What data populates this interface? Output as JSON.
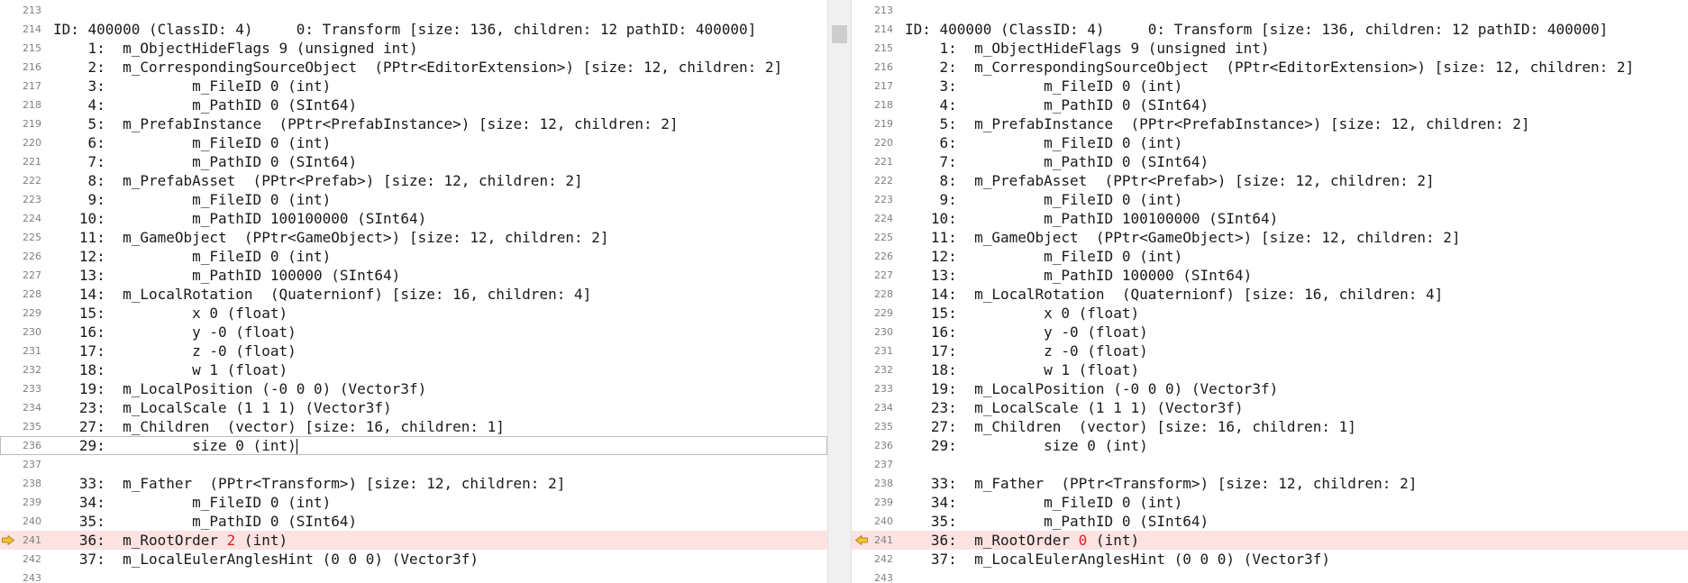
{
  "left": {
    "lines": [
      {
        "num": "213",
        "text": ""
      },
      {
        "num": "214",
        "text": "ID: 400000 (ClassID: 4)     0: Transform [size: 136, children: 12 pathID: 400000]"
      },
      {
        "num": "215",
        "text": "    1:  m_ObjectHideFlags 9 (unsigned int)"
      },
      {
        "num": "216",
        "text": "    2:  m_CorrespondingSourceObject  (PPtr<EditorExtension>) [size: 12, children: 2]"
      },
      {
        "num": "217",
        "text": "    3:          m_FileID 0 (int)"
      },
      {
        "num": "218",
        "text": "    4:          m_PathID 0 (SInt64)"
      },
      {
        "num": "219",
        "text": "    5:  m_PrefabInstance  (PPtr<PrefabInstance>) [size: 12, children: 2]"
      },
      {
        "num": "220",
        "text": "    6:          m_FileID 0 (int)"
      },
      {
        "num": "221",
        "text": "    7:          m_PathID 0 (SInt64)"
      },
      {
        "num": "222",
        "text": "    8:  m_PrefabAsset  (PPtr<Prefab>) [size: 12, children: 2]"
      },
      {
        "num": "223",
        "text": "    9:          m_FileID 0 (int)"
      },
      {
        "num": "224",
        "text": "   10:          m_PathID 100100000 (SInt64)"
      },
      {
        "num": "225",
        "text": "   11:  m_GameObject  (PPtr<GameObject>) [size: 12, children: 2]"
      },
      {
        "num": "226",
        "text": "   12:          m_FileID 0 (int)"
      },
      {
        "num": "227",
        "text": "   13:          m_PathID 100000 (SInt64)"
      },
      {
        "num": "228",
        "text": "   14:  m_LocalRotation  (Quaternionf) [size: 16, children: 4]"
      },
      {
        "num": "229",
        "text": "   15:          x 0 (float)"
      },
      {
        "num": "230",
        "text": "   16:          y -0 (float)"
      },
      {
        "num": "231",
        "text": "   17:          z -0 (float)"
      },
      {
        "num": "232",
        "text": "   18:          w 1 (float)"
      },
      {
        "num": "233",
        "text": "   19:  m_LocalPosition (-0 0 0) (Vector3f)"
      },
      {
        "num": "234",
        "text": "   23:  m_LocalScale (1 1 1) (Vector3f)"
      },
      {
        "num": "235",
        "text": "   27:  m_Children  (vector) [size: 16, children: 1]"
      },
      {
        "num": "236",
        "text": "   29:          size 0 (int)"
      },
      {
        "num": "237",
        "text": ""
      },
      {
        "num": "238",
        "text": "   33:  m_Father  (PPtr<Transform>) [size: 12, children: 2]"
      },
      {
        "num": "239",
        "text": "   34:          m_FileID 0 (int)"
      },
      {
        "num": "240",
        "text": "   35:          m_PathID 0 (SInt64)"
      },
      {
        "num": "241",
        "pre": "   36:  m_RootOrder ",
        "hl": "2",
        "post": " (int)"
      },
      {
        "num": "242",
        "text": "   37:  m_LocalEulerAnglesHint (0 0 0) (Vector3f)"
      },
      {
        "num": "243",
        "text": ""
      }
    ]
  },
  "right": {
    "lines": [
      {
        "num": "213",
        "text": ""
      },
      {
        "num": "214",
        "text": "ID: 400000 (ClassID: 4)     0: Transform [size: 136, children: 12 pathID: 400000]"
      },
      {
        "num": "215",
        "text": "    1:  m_ObjectHideFlags 9 (unsigned int)"
      },
      {
        "num": "216",
        "text": "    2:  m_CorrespondingSourceObject  (PPtr<EditorExtension>) [size: 12, children: 2]"
      },
      {
        "num": "217",
        "text": "    3:          m_FileID 0 (int)"
      },
      {
        "num": "218",
        "text": "    4:          m_PathID 0 (SInt64)"
      },
      {
        "num": "219",
        "text": "    5:  m_PrefabInstance  (PPtr<PrefabInstance>) [size: 12, children: 2]"
      },
      {
        "num": "220",
        "text": "    6:          m_FileID 0 (int)"
      },
      {
        "num": "221",
        "text": "    7:          m_PathID 0 (SInt64)"
      },
      {
        "num": "222",
        "text": "    8:  m_PrefabAsset  (PPtr<Prefab>) [size: 12, children: 2]"
      },
      {
        "num": "223",
        "text": "    9:          m_FileID 0 (int)"
      },
      {
        "num": "224",
        "text": "   10:          m_PathID 100100000 (SInt64)"
      },
      {
        "num": "225",
        "text": "   11:  m_GameObject  (PPtr<GameObject>) [size: 12, children: 2]"
      },
      {
        "num": "226",
        "text": "   12:          m_FileID 0 (int)"
      },
      {
        "num": "227",
        "text": "   13:          m_PathID 100000 (SInt64)"
      },
      {
        "num": "228",
        "text": "   14:  m_LocalRotation  (Quaternionf) [size: 16, children: 4]"
      },
      {
        "num": "229",
        "text": "   15:          x 0 (float)"
      },
      {
        "num": "230",
        "text": "   16:          y -0 (float)"
      },
      {
        "num": "231",
        "text": "   17:          z -0 (float)"
      },
      {
        "num": "232",
        "text": "   18:          w 1 (float)"
      },
      {
        "num": "233",
        "text": "   19:  m_LocalPosition (-0 0 0) (Vector3f)"
      },
      {
        "num": "234",
        "text": "   23:  m_LocalScale (1 1 1) (Vector3f)"
      },
      {
        "num": "235",
        "text": "   27:  m_Children  (vector) [size: 16, children: 1]"
      },
      {
        "num": "236",
        "text": "   29:          size 0 (int)"
      },
      {
        "num": "237",
        "text": ""
      },
      {
        "num": "238",
        "text": "   33:  m_Father  (PPtr<Transform>) [size: 12, children: 2]"
      },
      {
        "num": "239",
        "text": "   34:          m_FileID 0 (int)"
      },
      {
        "num": "240",
        "text": "   35:          m_PathID 0 (SInt64)"
      },
      {
        "num": "241",
        "pre": "   36:  m_RootOrder ",
        "hl": "0",
        "post": " (int)"
      },
      {
        "num": "242",
        "text": "   37:  m_LocalEulerAnglesHint (0 0 0) (Vector3f)"
      },
      {
        "num": "243",
        "text": ""
      }
    ]
  },
  "diff_line": "241",
  "current_line": "236",
  "colors": {
    "diff_background": "#fde2e2",
    "diff_text": "#e02020",
    "arrow_fill": "#f2c230",
    "line_number": "#808080"
  },
  "icons": {
    "left_marker": "arrow-right-icon",
    "right_marker": "arrow-left-icon"
  }
}
